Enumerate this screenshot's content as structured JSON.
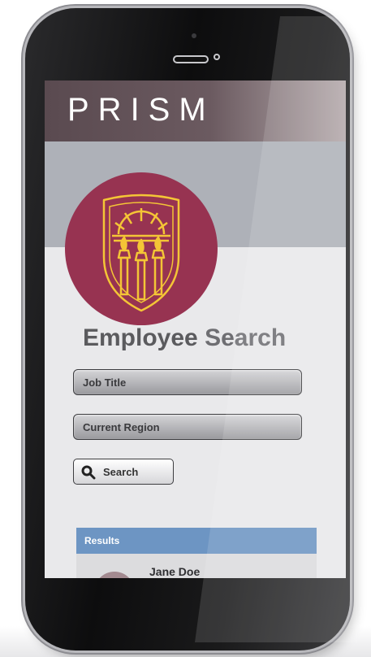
{
  "app": {
    "title": "PRISM"
  },
  "page": {
    "heading_part1": "Employee",
    "heading_part2": "Search"
  },
  "form": {
    "job_title_placeholder": "Job Title",
    "region_placeholder": "Current Region",
    "search_label": "Search"
  },
  "results": {
    "header": "Results",
    "items": [
      {
        "name": "Jane Doe"
      }
    ]
  },
  "colors": {
    "header": "#5a4a50",
    "logo_bg": "#973351",
    "logo_gold": "#f4c536",
    "results_header": "#6d95c3"
  }
}
